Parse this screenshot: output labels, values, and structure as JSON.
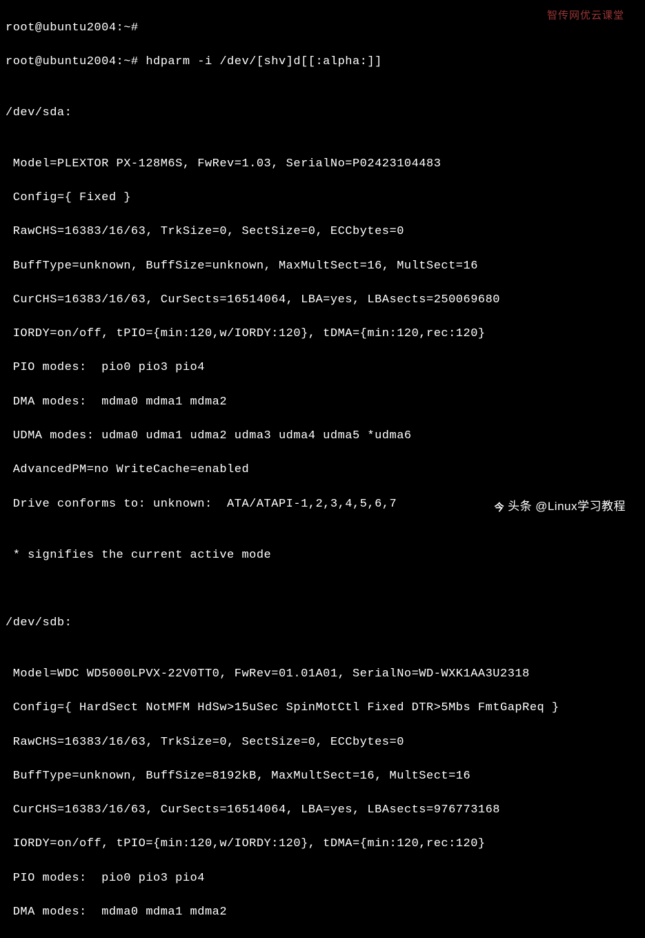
{
  "prompt1": "root@ubuntu2004:~#",
  "prompt2": "root@ubuntu2004:~# hdparm -i /dev/[shv]d[[:alpha:]]",
  "blank": "",
  "dev1_header": "/dev/sda:",
  "dev1": {
    "l1": " Model=PLEXTOR PX-128M6S, FwRev=1.03, SerialNo=P02423104483",
    "l2": " Config={ Fixed }",
    "l3": " RawCHS=16383/16/63, TrkSize=0, SectSize=0, ECCbytes=0",
    "l4": " BuffType=unknown, BuffSize=unknown, MaxMultSect=16, MultSect=16",
    "l5": " CurCHS=16383/16/63, CurSects=16514064, LBA=yes, LBAsects=250069680",
    "l6": " IORDY=on/off, tPIO={min:120,w/IORDY:120}, tDMA={min:120,rec:120}",
    "l7": " PIO modes:  pio0 pio3 pio4",
    "l8": " DMA modes:  mdma0 mdma1 mdma2",
    "l9": " UDMA modes: udma0 udma1 udma2 udma3 udma4 udma5 *udma6",
    "l10": " AdvancedPM=no WriteCache=enabled",
    "l11": " Drive conforms to: unknown:  ATA/ATAPI-1,2,3,4,5,6,7"
  },
  "note": " * signifies the current active mode",
  "dev2_header": "/dev/sdb:",
  "dev2": {
    "l1": " Model=WDC WD5000LPVX-22V0TT0, FwRev=01.01A01, SerialNo=WD-WXK1AA3U2318",
    "l2": " Config={ HardSect NotMFM HdSw>15uSec SpinMotCtl Fixed DTR>5Mbs FmtGapReq }",
    "l3": " RawCHS=16383/16/63, TrkSize=0, SectSize=0, ECCbytes=0",
    "l4": " BuffType=unknown, BuffSize=8192kB, MaxMultSect=16, MultSect=16",
    "l5": " CurCHS=16383/16/63, CurSects=16514064, LBA=yes, LBAsects=976773168",
    "l6": " IORDY=on/off, tPIO={min:120,w/IORDY:120}, tDMA={min:120,rec:120}",
    "l7": " PIO modes:  pio0 pio3 pio4",
    "l8": " DMA modes:  mdma0 mdma1 mdma2"
  },
  "watermark_top": "智传网优云课堂",
  "watermark_bottom_prefix": "头条",
  "watermark_bottom_handle": "@Linux学习教程"
}
